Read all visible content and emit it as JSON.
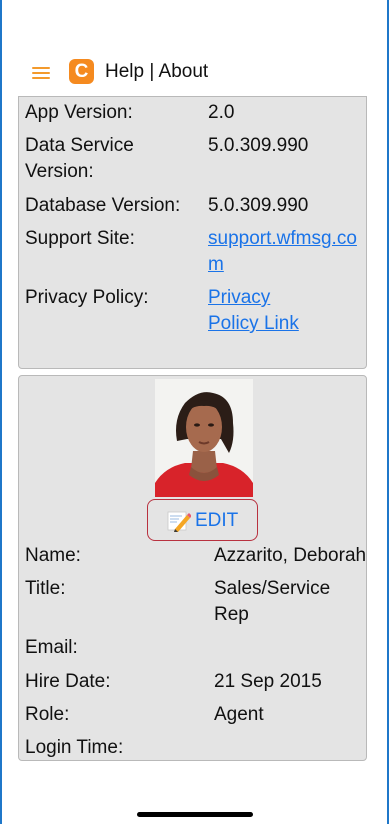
{
  "header": {
    "title": "Help | About",
    "logo_letter": "C"
  },
  "about": {
    "app_version_label": "App Version:",
    "app_version_value": "2.0",
    "data_service_label_1": "Data Service",
    "data_service_label_2": "Version:",
    "data_service_value": "5.0.309.990",
    "database_version_label": "Database Version:",
    "database_version_value": "5.0.309.990",
    "support_site_label": "Support Site:",
    "support_site_line1": "support.wfmsg.co",
    "support_site_line2": "m",
    "privacy_policy_label": "Privacy Policy:",
    "privacy_link_line1": "Privacy",
    "privacy_link_line2": "Policy Link"
  },
  "profile": {
    "edit_label": "EDIT",
    "name_label": "Name:",
    "name_value": "Azzarito, Deborah",
    "title_label": "Title:",
    "title_value_1": "Sales/Service",
    "title_value_2": "Rep",
    "email_label": "Email:",
    "email_value": "",
    "hire_date_label": "Hire Date:",
    "hire_date_value": "21 Sep 2015",
    "role_label": "Role:",
    "role_value": "Agent",
    "login_time_label": "Login Time:",
    "login_time_value": ""
  },
  "colors": {
    "accent": "#f39a2c",
    "logo": "#f58a1f",
    "link": "#1a73e8",
    "card_bg": "#e4e4e4",
    "edit_border": "#b8313f",
    "frame": "#1f77c9"
  },
  "icons": {
    "menu": "hamburger-icon",
    "logo": "app-logo-icon",
    "edit": "pencil-memo-icon"
  }
}
